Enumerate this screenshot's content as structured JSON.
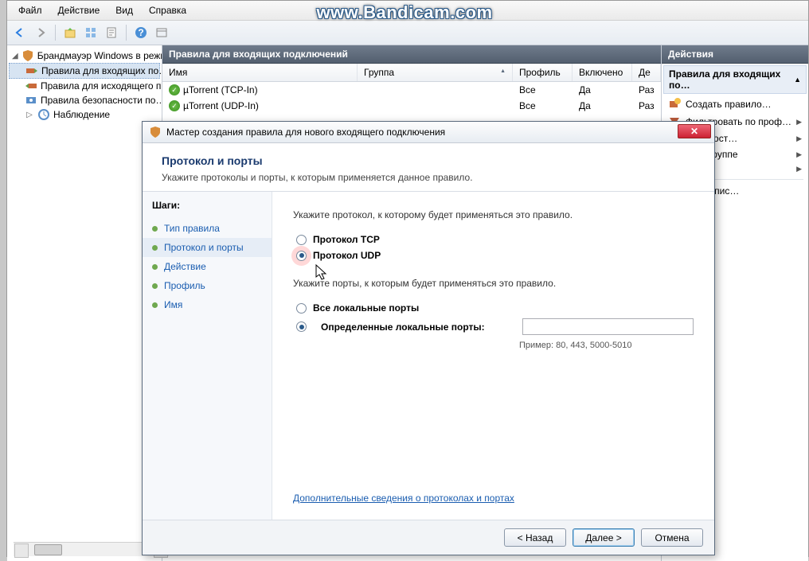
{
  "watermark": "www.Bandicam.com",
  "menu": {
    "file": "Файл",
    "action": "Действие",
    "view": "Вид",
    "help": "Справка"
  },
  "tree": {
    "root": "Брандмауэр Windows в режим",
    "inbound": "Правила для входящих по…",
    "outbound": "Правила для исходящего п…",
    "security": "Правила безопасности по…",
    "monitoring": "Наблюдение"
  },
  "middle": {
    "header": "Правила для входящих подключений",
    "cols": {
      "name": "Имя",
      "group": "Группа",
      "profile": "Профиль",
      "enabled": "Включено",
      "action": "Де"
    },
    "rows": [
      {
        "name": "µTorrent (TCP-In)",
        "profile": "Все",
        "enabled": "Да",
        "action": "Раз"
      },
      {
        "name": "µTorrent (UDP-In)",
        "profile": "Все",
        "enabled": "Да",
        "action": "Раз"
      }
    ]
  },
  "actions": {
    "header": "Действия",
    "subheader": "Правила для входящих по…",
    "items": {
      "create": "Создать правило…",
      "filter_profile": "Фильтровать по проф…",
      "filter_state": "овать по сост…",
      "filter_group": "овать по группе",
      "export": "гировать спис…"
    }
  },
  "wizard": {
    "title": "Мастер создания правила для нового входящего подключения",
    "heading": "Протокол и порты",
    "subheading": "Укажите протоколы и порты, к которым применяется данное правило.",
    "steps_label": "Шаги:",
    "steps": {
      "type": "Тип правила",
      "protocol": "Протокол и порты",
      "action": "Действие",
      "profile": "Профиль",
      "name": "Имя"
    },
    "q_protocol": "Укажите протокол, к которому будет применяться это правило.",
    "tcp": "Протокол TCP",
    "udp": "Протокол UDP",
    "q_ports": "Укажите порты, к которым будет применяться это правило.",
    "all_ports": "Все локальные порты",
    "specific_ports": "Определенные локальные порты:",
    "hint": "Пример: 80, 443, 5000-5010",
    "link": "Дополнительные сведения о протоколах и портах",
    "back": "< Назад",
    "next": "Далее >",
    "cancel": "Отмена"
  }
}
